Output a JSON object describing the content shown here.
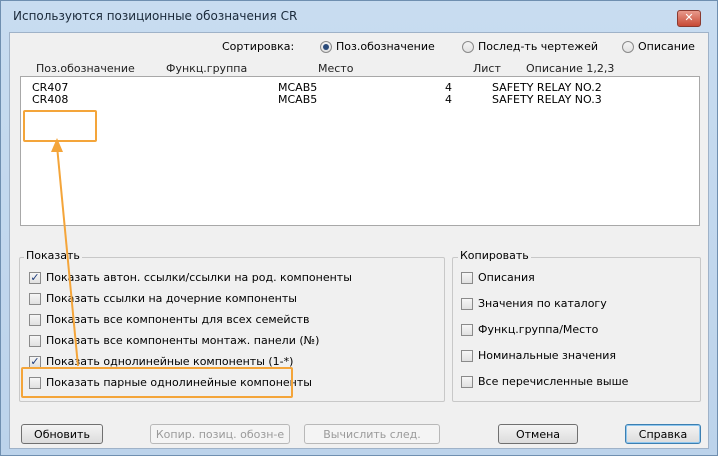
{
  "window": {
    "title": "Используются позиционные обозначения CR"
  },
  "sort": {
    "label": "Сортировка:",
    "options": [
      {
        "label": "Поз.обозначение",
        "selected": true
      },
      {
        "label": "Послед-ть чертежей",
        "selected": false
      },
      {
        "label": "Описание",
        "selected": false
      }
    ]
  },
  "list": {
    "columns": [
      "Поз.обозначение",
      "Функц.группа",
      "Место",
      "Лист",
      "Описание 1,2,3"
    ],
    "rows": [
      {
        "tag": "CR407",
        "group": "",
        "location": "MCAB5",
        "sheet": "4",
        "description": "SAFETY RELAY NO.2"
      },
      {
        "tag": "CR408",
        "group": "",
        "location": "MCAB5",
        "sheet": "4",
        "description": "SAFETY RELAY NO.3"
      }
    ]
  },
  "show": {
    "title": "Показать",
    "items": [
      {
        "label": "Показать автон. ссылки/ссылки на род. компоненты",
        "checked": true
      },
      {
        "label": "Показать ссылки на дочерние компоненты",
        "checked": false
      },
      {
        "label": "Показать все компоненты для всех семейств",
        "checked": false
      },
      {
        "label": "Показать все компоненты монтаж. панели (№)",
        "checked": false
      },
      {
        "label": "Показать однолинейные компоненты (1-*)",
        "checked": true
      },
      {
        "label": "Показать парные однолинейные компоненты",
        "checked": false
      }
    ]
  },
  "copy": {
    "title": "Копировать",
    "items": [
      {
        "label": "Описания",
        "checked": false
      },
      {
        "label": "Значения по каталогу",
        "checked": false
      },
      {
        "label": "Функц.группа/Место",
        "checked": false
      },
      {
        "label": "Номинальные значения",
        "checked": false
      },
      {
        "label": "Все перечисленные выше",
        "checked": false
      }
    ]
  },
  "buttons": {
    "refresh": "Обновить",
    "copy_tag": "Копир. позиц. обозн-е",
    "calc_next": "Вычислить след.",
    "cancel": "Отмена",
    "help": "Справка"
  },
  "icons": {
    "close": "close-icon",
    "check": "check-icon"
  },
  "colors": {
    "highlight": "#f4a53a",
    "title_bar": "#c8dcf0"
  }
}
